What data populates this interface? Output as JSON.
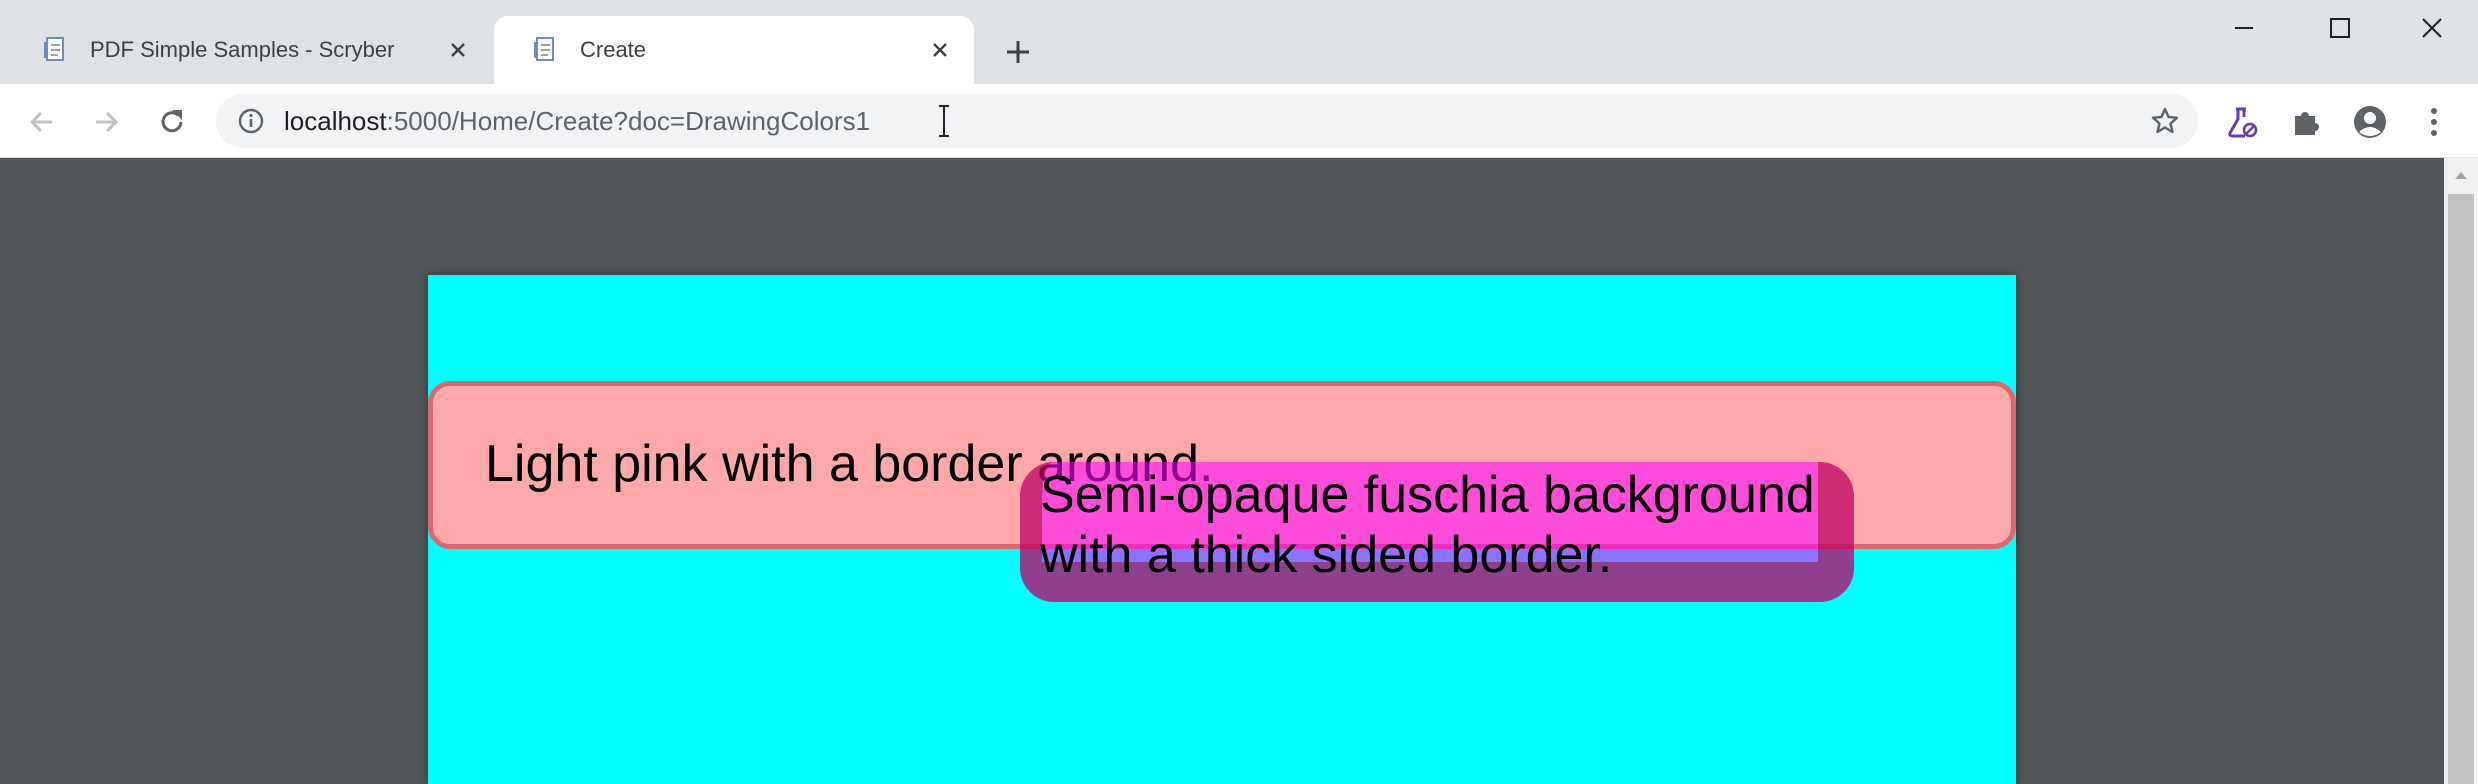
{
  "browser": {
    "tabs": [
      {
        "title": "PDF Simple Samples - Scryber",
        "active": false
      },
      {
        "title": "Create",
        "active": true
      }
    ],
    "url_host": "localhost",
    "url_rest": ":5000/Home/Create?doc=DrawingColors1",
    "icons": {
      "back": "back-arrow-icon",
      "forward": "forward-arrow-icon",
      "reload": "reload-icon",
      "info": "info-icon",
      "star": "star-icon",
      "labs": "flask-icon",
      "extensions": "puzzle-icon",
      "profile": "profile-icon",
      "menu": "kebab-menu-icon"
    }
  },
  "document": {
    "page_color": "#00ffff",
    "pink_box": {
      "text": "Light pink with a border around.",
      "background": "#ffa8aa",
      "border": "#d9696e"
    },
    "fuchsia_box": {
      "text": "Semi-opaque fuschia background with a thick sided border.",
      "background": "rgba(255,0,255,0.55)"
    }
  }
}
